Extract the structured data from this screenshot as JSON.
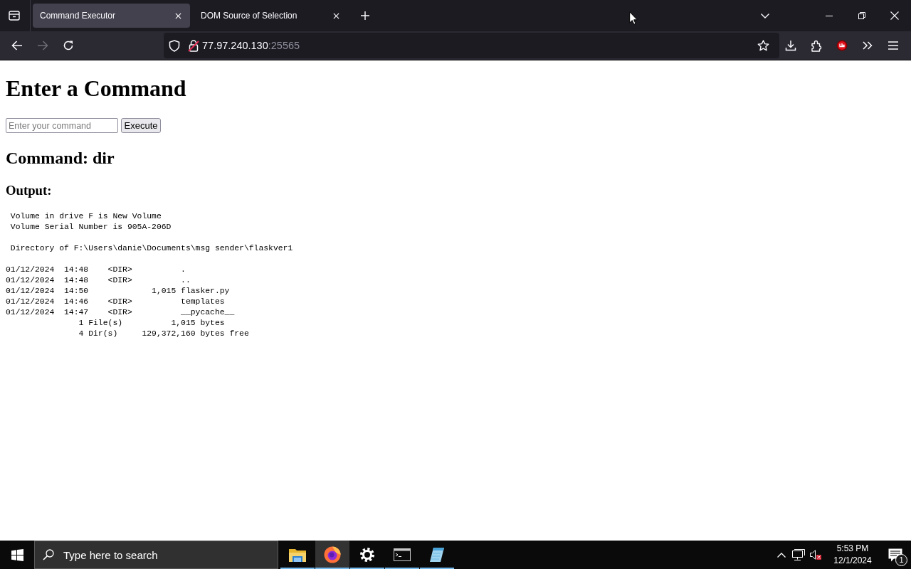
{
  "browser": {
    "tabs": [
      {
        "title": "Command Executor",
        "selected": true
      },
      {
        "title": "DOM Source of Selection",
        "selected": false
      }
    ],
    "nav_buttons": [
      {
        "kind": "back",
        "disabled": false
      },
      {
        "kind": "forward",
        "disabled": true
      },
      {
        "kind": "reload",
        "disabled": false
      }
    ],
    "address": {
      "host": "77.97.240.130",
      "port": ":25565"
    }
  },
  "page": {
    "title": "Enter a Command",
    "command_field": {
      "placeholder": "Enter your command"
    },
    "execute_button": "Execute",
    "command_heading": "Command: dir",
    "output_heading": "Output:",
    "output": [
      [
        " Volume in drive F is New Volume",
        " Volume Serial Number is 905A-206D"
      ],
      [
        " Directory of F:\\Users\\danie\\Documents\\msg sender\\flaskver1"
      ],
      [
        "01/12/2024  14:48    <DIR>          .",
        "01/12/2024  14:48    <DIR>          ..",
        "01/12/2024  14:50             1,015 flasker.py",
        "01/12/2024  14:46    <DIR>          templates",
        "01/12/2024  14:47    <DIR>          __pycache__",
        "               1 File(s)          1,015 bytes",
        "               4 Dir(s)     129,372,160 bytes free"
      ]
    ]
  },
  "taskbar": {
    "search": {
      "placeholder": "Type here to search"
    },
    "apps": [
      {
        "kind": "folder",
        "running": true,
        "selected": false
      },
      {
        "kind": "browser",
        "running": true,
        "selected": true
      },
      {
        "kind": "settings",
        "running": true,
        "selected": false
      },
      {
        "kind": "terminal",
        "running": true,
        "selected": false
      },
      {
        "kind": "notepad",
        "running": true,
        "selected": false
      }
    ],
    "clock": {
      "time": "5:53 PM",
      "date": "12/1/2024"
    },
    "notification_count": "1"
  }
}
